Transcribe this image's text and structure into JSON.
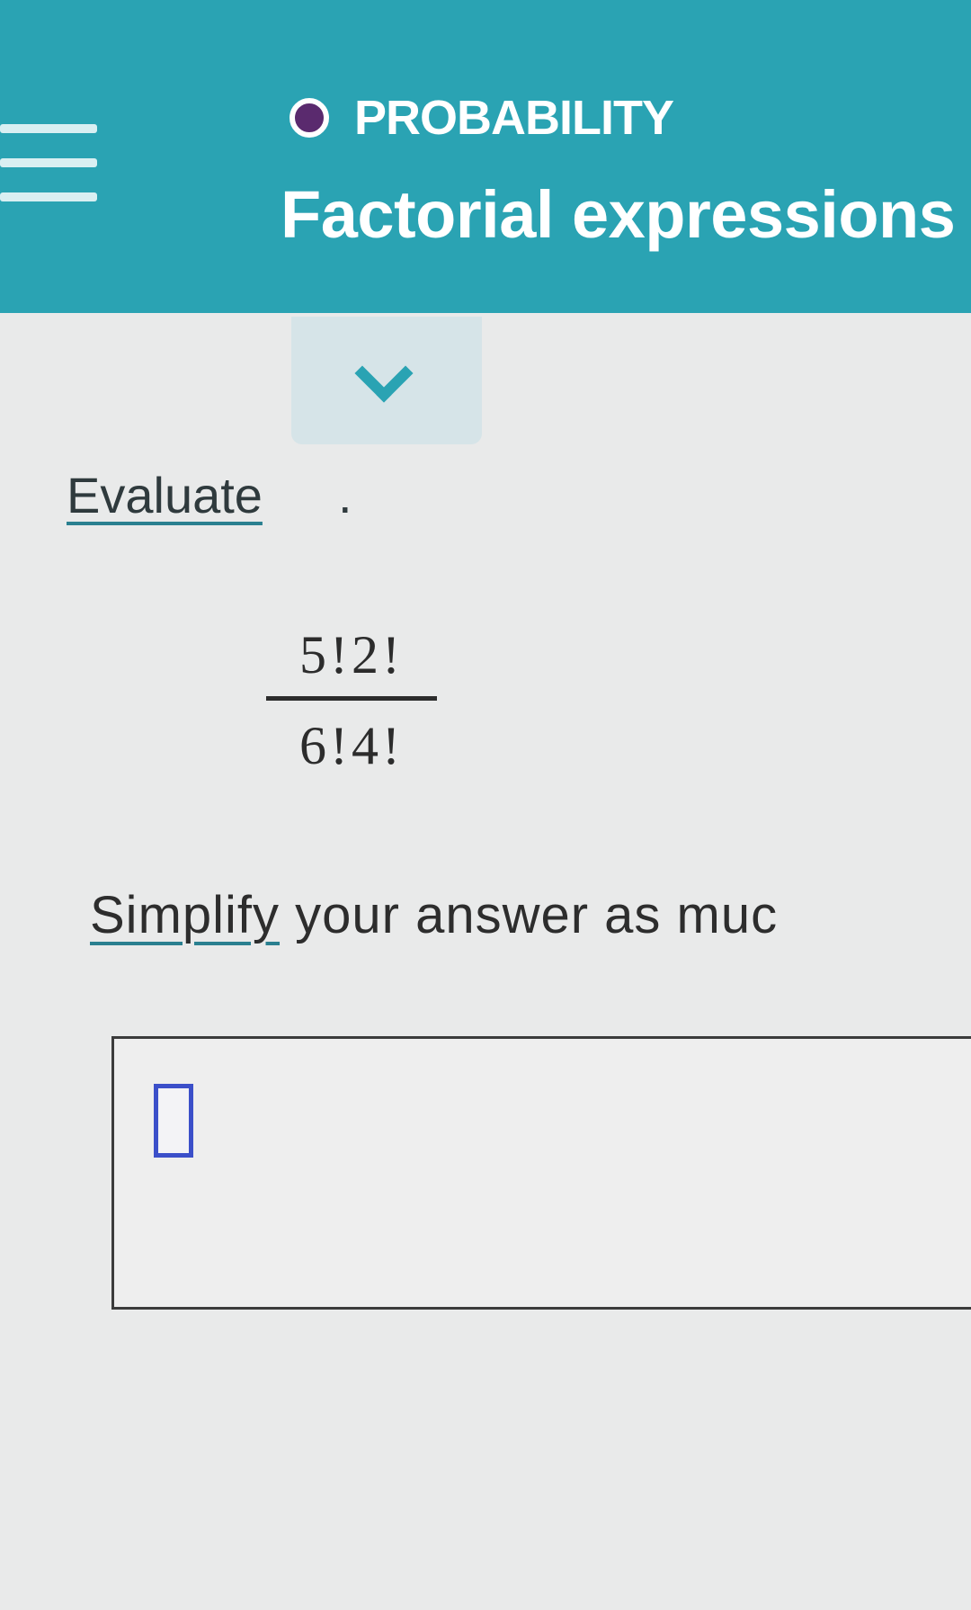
{
  "header": {
    "category": "PROBABILITY",
    "title": "Factorial expressions",
    "accent_color": "#2aa3b3",
    "category_dot_color": "#5a2a6e"
  },
  "icons": {
    "menu": "hamburger-menu-icon",
    "collapse": "chevron-down-icon"
  },
  "question": {
    "instruction": "Evaluate",
    "instruction_punct": ".",
    "numerator": "5!2!",
    "denominator": "6!4!",
    "simplify_link": "Simplify",
    "simplify_rest": " your answer as muc"
  },
  "answer": {
    "value": ""
  }
}
